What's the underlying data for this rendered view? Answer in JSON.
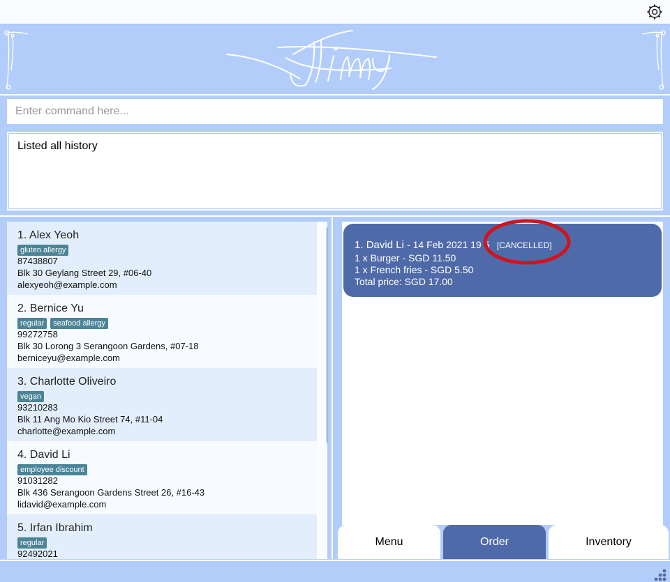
{
  "app": {
    "logo_text": "Jimy",
    "colors": {
      "background": "#b3cdfa",
      "accent": "#4f6aa8",
      "tag": "#4b8497",
      "annotation": "#d0141c"
    }
  },
  "topbar": {
    "settings_icon": "gear-icon"
  },
  "command": {
    "placeholder": "Enter command here...",
    "value": ""
  },
  "result": {
    "message": "Listed all history"
  },
  "persons": [
    {
      "index": "1.",
      "name": "Alex Yeoh",
      "tags": [
        "gluten allergy"
      ],
      "phone": "87438807",
      "address": "Blk 30 Geylang Street 29, #06-40",
      "email": "alexyeoh@example.com"
    },
    {
      "index": "2.",
      "name": "Bernice Yu",
      "tags": [
        "regular",
        "seafood allergy"
      ],
      "phone": "99272758",
      "address": "Blk 30 Lorong 3 Serangoon Gardens, #07-18",
      "email": "berniceyu@example.com"
    },
    {
      "index": "3.",
      "name": "Charlotte Oliveiro",
      "tags": [
        "vegan"
      ],
      "phone": "93210283",
      "address": "Blk 11 Ang Mo Kio Street 74, #11-04",
      "email": "charlotte@example.com"
    },
    {
      "index": "4.",
      "name": "David Li",
      "tags": [
        "employee discount"
      ],
      "phone": "91031282",
      "address": "Blk 436 Serangoon Gardens Street 26, #16-43",
      "email": "lidavid@example.com"
    },
    {
      "index": "5.",
      "name": "Irfan Ibrahim",
      "tags": [
        "regular"
      ],
      "phone": "92492021",
      "address": "",
      "email": ""
    }
  ],
  "orders": [
    {
      "index": "1.",
      "customer": "David Li",
      "date": "- 14 Feb 2021 19",
      "date_suffix": "5",
      "status": "[CANCELLED]",
      "items": [
        "1 x Burger - SGD 11.50",
        "1 x French fries - SGD 5.50"
      ],
      "total": "Total price: SGD 17.00"
    }
  ],
  "tabs": [
    {
      "label": "Menu",
      "active": false
    },
    {
      "label": "Order",
      "active": true
    },
    {
      "label": "Inventory",
      "active": false
    }
  ]
}
